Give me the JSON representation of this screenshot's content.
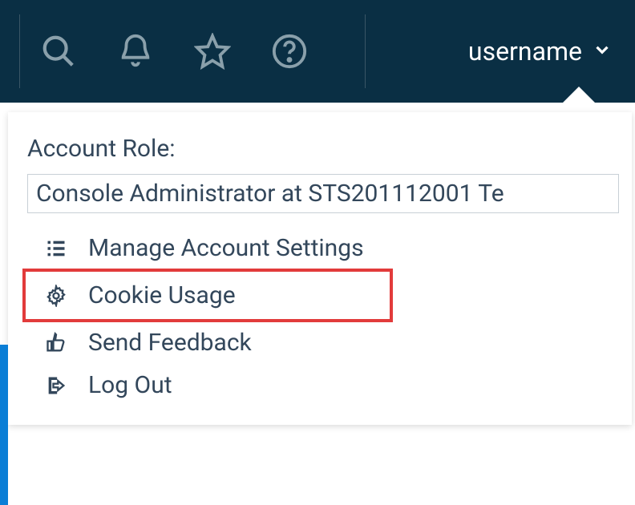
{
  "header": {
    "username": "username"
  },
  "dropdown": {
    "role_label": "Account Role:",
    "role_value": "Console Administrator at STS201112001 Te",
    "items": [
      {
        "label": "Manage Account Settings"
      },
      {
        "label": "Cookie Usage"
      },
      {
        "label": "Send Feedback"
      },
      {
        "label": "Log Out"
      }
    ]
  }
}
